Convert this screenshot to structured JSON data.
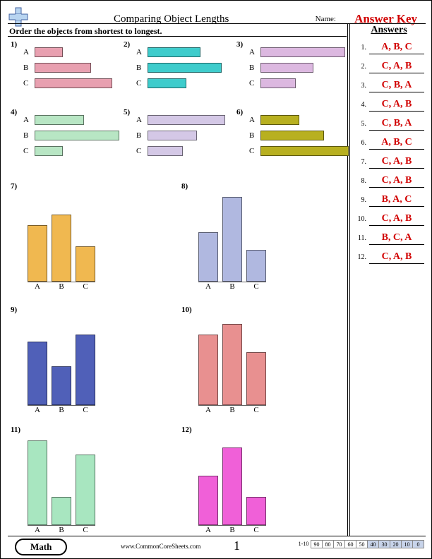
{
  "header": {
    "title": "Comparing Object Lengths",
    "name_label": "Name:",
    "answer_key": "Answer Key"
  },
  "instruction": "Order the objects from shortest to longest.",
  "answers_header": "Answers",
  "answers": [
    "A, B, C",
    "C, A, B",
    "C, B, A",
    "C, A, B",
    "C, B, A",
    "A, B, C",
    "C, A, B",
    "C, A, B",
    "B, A, C",
    "C, A, B",
    "B, C, A",
    "C, A, B"
  ],
  "footer": {
    "subject": "Math",
    "site": "www.CommonCoreSheets.com",
    "page": "1",
    "score_label": "1-10",
    "scores": [
      "90",
      "80",
      "70",
      "60",
      "50",
      "40",
      "30",
      "20",
      "10",
      "0"
    ]
  },
  "chart_data": [
    {
      "id": 1,
      "type": "bar",
      "orientation": "horizontal",
      "categories": [
        "A",
        "B",
        "C"
      ],
      "values": [
        40,
        80,
        110
      ],
      "color": "#e8a0b0"
    },
    {
      "id": 2,
      "type": "bar",
      "orientation": "horizontal",
      "categories": [
        "A",
        "B",
        "C"
      ],
      "values": [
        75,
        105,
        55
      ],
      "color": "#3ecccc"
    },
    {
      "id": 3,
      "type": "bar",
      "orientation": "horizontal",
      "categories": [
        "A",
        "B",
        "C"
      ],
      "values": [
        120,
        75,
        50
      ],
      "color": "#dcb8e0"
    },
    {
      "id": 4,
      "type": "bar",
      "orientation": "horizontal",
      "categories": [
        "A",
        "B",
        "C"
      ],
      "values": [
        70,
        120,
        40
      ],
      "color": "#b8e6c4"
    },
    {
      "id": 5,
      "type": "bar",
      "orientation": "horizontal",
      "categories": [
        "A",
        "B",
        "C"
      ],
      "values": [
        110,
        70,
        50
      ],
      "color": "#d4c8e6"
    },
    {
      "id": 6,
      "type": "bar",
      "orientation": "horizontal",
      "categories": [
        "A",
        "B",
        "C"
      ],
      "values": [
        55,
        90,
        125
      ],
      "color": "#b8b020"
    },
    {
      "id": 7,
      "type": "bar",
      "orientation": "vertical",
      "categories": [
        "A",
        "B",
        "C"
      ],
      "values": [
        80,
        95,
        50
      ],
      "color": "#f0b850"
    },
    {
      "id": 8,
      "type": "bar",
      "orientation": "vertical",
      "categories": [
        "A",
        "B",
        "C"
      ],
      "values": [
        70,
        120,
        45
      ],
      "color": "#b0b8e0"
    },
    {
      "id": 9,
      "type": "bar",
      "orientation": "vertical",
      "categories": [
        "A",
        "B",
        "C"
      ],
      "values": [
        90,
        55,
        100
      ],
      "color": "#5060b8"
    },
    {
      "id": 10,
      "type": "bar",
      "orientation": "vertical",
      "categories": [
        "A",
        "B",
        "C"
      ],
      "values": [
        100,
        115,
        75
      ],
      "color": "#e89090"
    },
    {
      "id": 11,
      "type": "bar",
      "orientation": "vertical",
      "categories": [
        "A",
        "B",
        "C"
      ],
      "values": [
        120,
        40,
        100
      ],
      "color": "#a8e6c0"
    },
    {
      "id": 12,
      "type": "bar",
      "orientation": "vertical",
      "categories": [
        "A",
        "B",
        "C"
      ],
      "values": [
        70,
        110,
        40
      ],
      "color": "#f060d8"
    }
  ]
}
